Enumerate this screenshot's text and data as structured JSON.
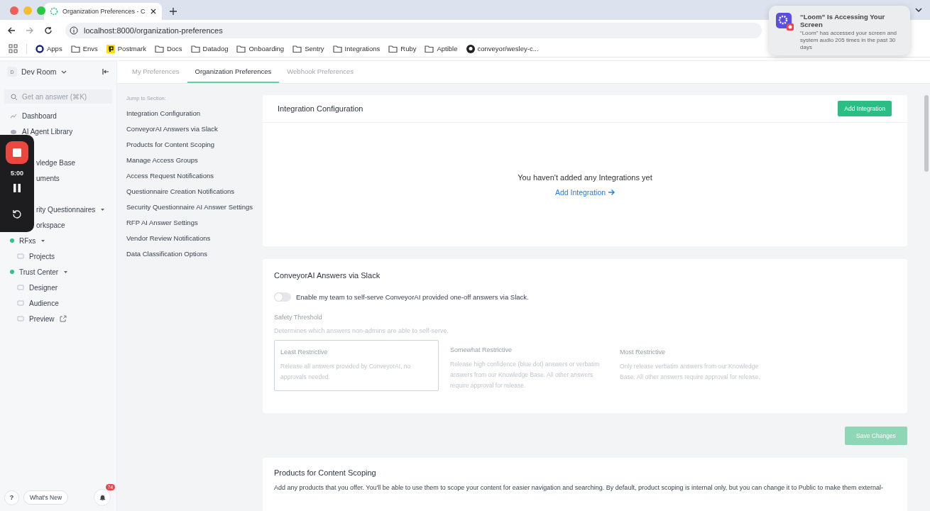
{
  "browser": {
    "tab_title": "Organization Preferences - C",
    "url": "localhost:8000/organization-preferences",
    "bookmarks": [
      {
        "label": "Apps",
        "kind": "apps"
      },
      {
        "label": "Envs",
        "kind": "folder"
      },
      {
        "label": "Postmark",
        "kind": "postmark"
      },
      {
        "label": "Docs",
        "kind": "folder"
      },
      {
        "label": "Datadog",
        "kind": "folder"
      },
      {
        "label": "Onboarding",
        "kind": "folder"
      },
      {
        "label": "Sentry",
        "kind": "folder"
      },
      {
        "label": "Integrations",
        "kind": "folder"
      },
      {
        "label": "Ruby",
        "kind": "folder"
      },
      {
        "label": "Aptible",
        "kind": "folder"
      },
      {
        "label": "conveyor/wesley-c...",
        "kind": "github"
      }
    ]
  },
  "notification": {
    "title": "“Loom” Is Accessing Your Screen",
    "body": "“Loom” has accessed your screen and system audio 205 times in the past 30 days"
  },
  "recorder": {
    "time": "5:00"
  },
  "sidebar": {
    "workspace": "Dev Room",
    "workspace_initial": "D",
    "search": {
      "placeholder": "Get an answer (⌘K)"
    },
    "items": [
      {
        "label": "Dashboard",
        "kind": "link",
        "under_recorder": false
      },
      {
        "label": "AI Agent Library",
        "kind": "link",
        "under_recorder": false
      },
      {
        "label": "vledge Base",
        "kind": "link",
        "under_recorder": true
      },
      {
        "label": "uments",
        "kind": "link",
        "under_recorder": true
      },
      {
        "label": "rity Questionnaires",
        "kind": "group",
        "under_recorder": true,
        "expanded": true,
        "children": [
          {
            "label": "orkspace",
            "kind": "link",
            "under_recorder": true
          }
        ]
      },
      {
        "label": "RFxs",
        "kind": "group",
        "under_recorder": false,
        "expanded": true,
        "children": [
          {
            "label": "Projects",
            "kind": "link",
            "under_recorder": false
          }
        ]
      },
      {
        "label": "Trust Center",
        "kind": "group",
        "under_recorder": false,
        "expanded": true,
        "children": [
          {
            "label": "Designer",
            "kind": "link",
            "under_recorder": false
          },
          {
            "label": "Audience",
            "kind": "link",
            "under_recorder": false
          },
          {
            "label": "Preview",
            "kind": "external",
            "under_recorder": false
          }
        ]
      }
    ],
    "help": "?",
    "whats_new": "What's New",
    "notification_count": "74"
  },
  "tabs": [
    {
      "label": "My Preferences",
      "selected": false
    },
    {
      "label": "Organization Preferences",
      "selected": true
    },
    {
      "label": "Webhook Preferences",
      "selected": false
    }
  ],
  "jump": {
    "heading": "Jump to Section:",
    "links": [
      "Integration Configuration",
      "ConveyorAI Answers via Slack",
      "Products for Content Scoping",
      "Manage Access Groups",
      "Access Request Notifications",
      "Questionnaire Creation Notifications",
      "Security Questionnaire AI Answer Settings",
      "RFP AI Answer Settings",
      "Vendor Review Notifications",
      "Data Classification Options"
    ]
  },
  "integration": {
    "title": "Integration Configuration",
    "button": "Add Integration",
    "empty_text": "You haven't added any Integrations yet",
    "link": "Add Integration"
  },
  "slack": {
    "title": "ConveyorAI Answers via Slack",
    "toggle": {
      "label": "Enable my team to self-serve ConveyorAI provided one-off answers via Slack.",
      "on": false
    },
    "threshold_label": "Safety Threshold",
    "threshold_hint": "Determines which answers non-admins are able to self-serve.",
    "options": [
      {
        "title": "Least Restrictive",
        "text": "Release all answers provided by ConveyorAI, no approvals needed.",
        "selected": true
      },
      {
        "title": "Somewhat Restrictive",
        "text": "Release high confidence (blue dot) answers or verbatim answers from our Knowledge Base. All other answers require approval for release.",
        "selected": false
      },
      {
        "title": "Most Restrictive",
        "text": "Only release verbatim answers from our Knowledge Base. All other answers require approval for release.",
        "selected": false
      }
    ]
  },
  "save": {
    "label": "Save Changes",
    "disabled": true
  },
  "products": {
    "title": "Products for Content Scoping",
    "text": "Add any products that you offer. You'll be able to use them to scope your content for easier navigation and searching. By default, product scoping is internal only, but you can change it to Public to make them external-"
  }
}
